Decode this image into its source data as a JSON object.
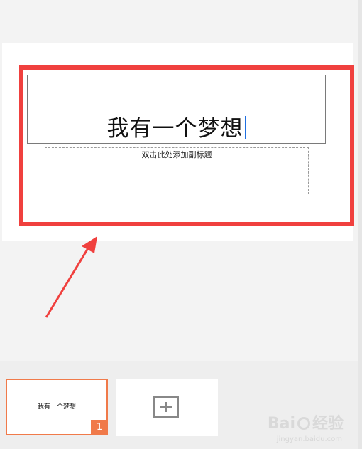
{
  "slide": {
    "title_text": "我有一个梦想",
    "subtitle_placeholder": "双击此处添加副标题"
  },
  "thumbnails": [
    {
      "title": "我有一个梦想",
      "number": "1"
    }
  ],
  "watermark": {
    "brand": "Bai",
    "brand_suffix": "经验",
    "site": "jingyan.baidu.com"
  },
  "colors": {
    "highlight": "#f0403e",
    "selected_thumb": "#f07a4a",
    "caret": "#1f6fe0"
  }
}
